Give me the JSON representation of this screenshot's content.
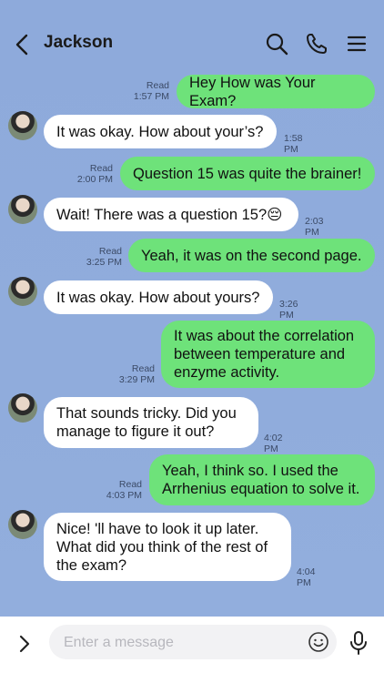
{
  "header": {
    "title": "Jackson"
  },
  "messages": [
    {
      "dir": "out",
      "text": "Hey How was Your Exam?",
      "read": "Read",
      "time": "1:57 PM"
    },
    {
      "dir": "in",
      "text": "It was okay. How about your’s?",
      "time": "1:58 PM"
    },
    {
      "dir": "out",
      "text": "Question 15 was quite the brainer!",
      "read": "Read",
      "time": "2:00 PM"
    },
    {
      "dir": "in",
      "text": "Wait! There was a question 15?😔",
      "time": "2:03 PM"
    },
    {
      "dir": "out",
      "text": "Yeah, it was on the second page.",
      "read": "Read",
      "time": "3:25 PM"
    },
    {
      "dir": "in",
      "text": "It was okay. How about yours?",
      "time": "3:26 PM"
    },
    {
      "dir": "out",
      "text": "It was about the correlation\nbetween temperature and\nenzyme activity.",
      "read": "Read",
      "time": "3:29 PM"
    },
    {
      "dir": "in",
      "text": "That sounds tricky. Did you\nmanage to figure it out?",
      "time": "4:02 PM"
    },
    {
      "dir": "out",
      "text": "Yeah, I think so. I used the\nArrhenius equation to solve it.",
      "read": "Read",
      "time": "4:03 PM"
    },
    {
      "dir": "in",
      "text": "Nice! 'll have to look it up later.\nWhat did you think of the rest of\nthe exam?",
      "time": "4:04 PM"
    }
  ],
  "input": {
    "placeholder": "Enter a message"
  },
  "colors": {
    "outgoing": "#6ee27a",
    "incoming": "#ffffff",
    "background": "#8eaadb"
  },
  "icons": [
    "back-chevron-icon",
    "search-icon",
    "phone-icon",
    "menu-icon",
    "expand-chevron-icon",
    "emoji-icon",
    "microphone-icon"
  ]
}
